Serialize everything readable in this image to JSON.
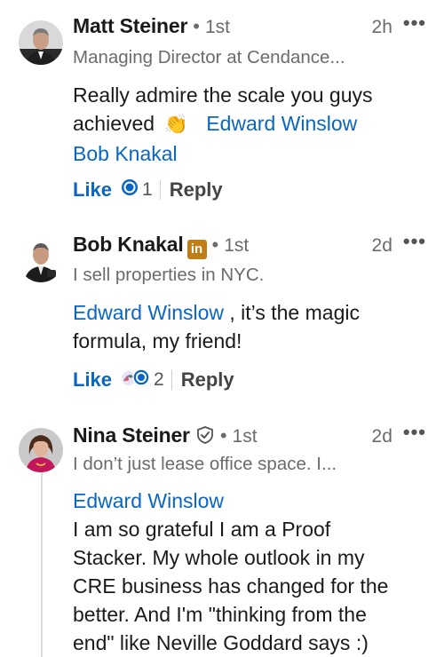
{
  "comments": [
    {
      "name": "Matt Steiner",
      "degree": "1st",
      "time": "2h",
      "more": "•••",
      "headline": "Managing Director at Cendance...",
      "body_line1_text": "Really admire the scale you guys",
      "body_line2_text": "achieved",
      "emoji": "👏",
      "mention1": "Edward Winslow",
      "mention2": "Bob Knakal",
      "like_label": "Like",
      "reaction_count": "1",
      "reply_label": "Reply"
    },
    {
      "name": "Bob Knakal",
      "badge": "in",
      "degree": "1st",
      "time": "2d",
      "more": "•••",
      "headline": "I sell properties in NYC.",
      "mention": "Edward Winslow",
      "body_after_mention": " , it’s the magic",
      "body_line2": "formula, my friend!",
      "like_label": "Like",
      "reaction_count": "2",
      "reply_label": "Reply"
    },
    {
      "name": "Nina Steiner",
      "degree": "1st",
      "time": "2d",
      "more": "•••",
      "headline": "I don’t just lease office space. I...",
      "mention": "Edward Winslow",
      "body_lines": [
        "I am so grateful I am a Proof",
        "Stacker. My whole outlook in my",
        "CRE business has changed for the",
        "better. And I'm \"thinking from the",
        "end\" like Neville Goddard says :)"
      ]
    }
  ],
  "colors": {
    "link": "#0a66c2",
    "muted": "#6b6b6b",
    "text": "#1a1a1a"
  },
  "icons": [
    "clap-emoji",
    "like-reaction-icon",
    "celebrate-reaction-icon",
    "more-icon",
    "verified-shield-icon",
    "linkedin-badge-icon"
  ]
}
